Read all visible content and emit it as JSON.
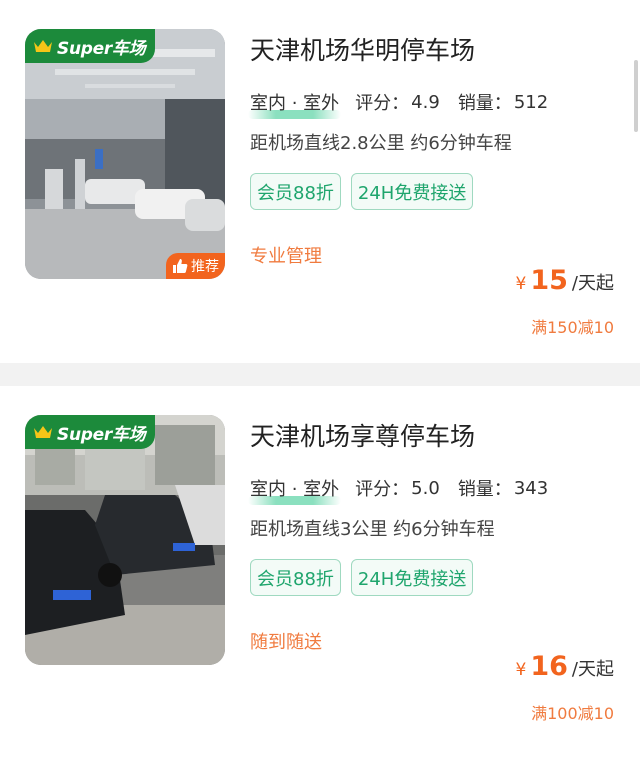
{
  "listings": [
    {
      "super_badge": "Super车场",
      "recommend_badge": "推荐",
      "title": "天津机场华明停车场",
      "location_type": "室内 · 室外",
      "rating_label": "评分：",
      "rating": "4.9",
      "sales_label": "销量：",
      "sales": "512",
      "distance": "距机场直线2.8公里 约6分钟车程",
      "tags": [
        "会员88折",
        "24H免费接送"
      ],
      "feature": "专业管理",
      "price_currency": "¥",
      "price": "15",
      "price_unit": "/天起",
      "discount": "满150减10"
    },
    {
      "super_badge": "Super车场",
      "title": "天津机场享尊停车场",
      "location_type": "室内 · 室外",
      "rating_label": "评分：",
      "rating": "5.0",
      "sales_label": "销量：",
      "sales": "343",
      "distance": "距机场直线3公里 约6分钟车程",
      "tags": [
        "会员88折",
        "24H免费接送"
      ],
      "feature": "随到随送",
      "price_currency": "¥",
      "price": "16",
      "price_unit": "/天起",
      "discount": "满100减10"
    }
  ],
  "colors": {
    "badge_green": "#1c8a3b",
    "recommend_orange": "#f2641e",
    "tag_green": "#1fa56d",
    "price_orange": "#f2641e"
  }
}
